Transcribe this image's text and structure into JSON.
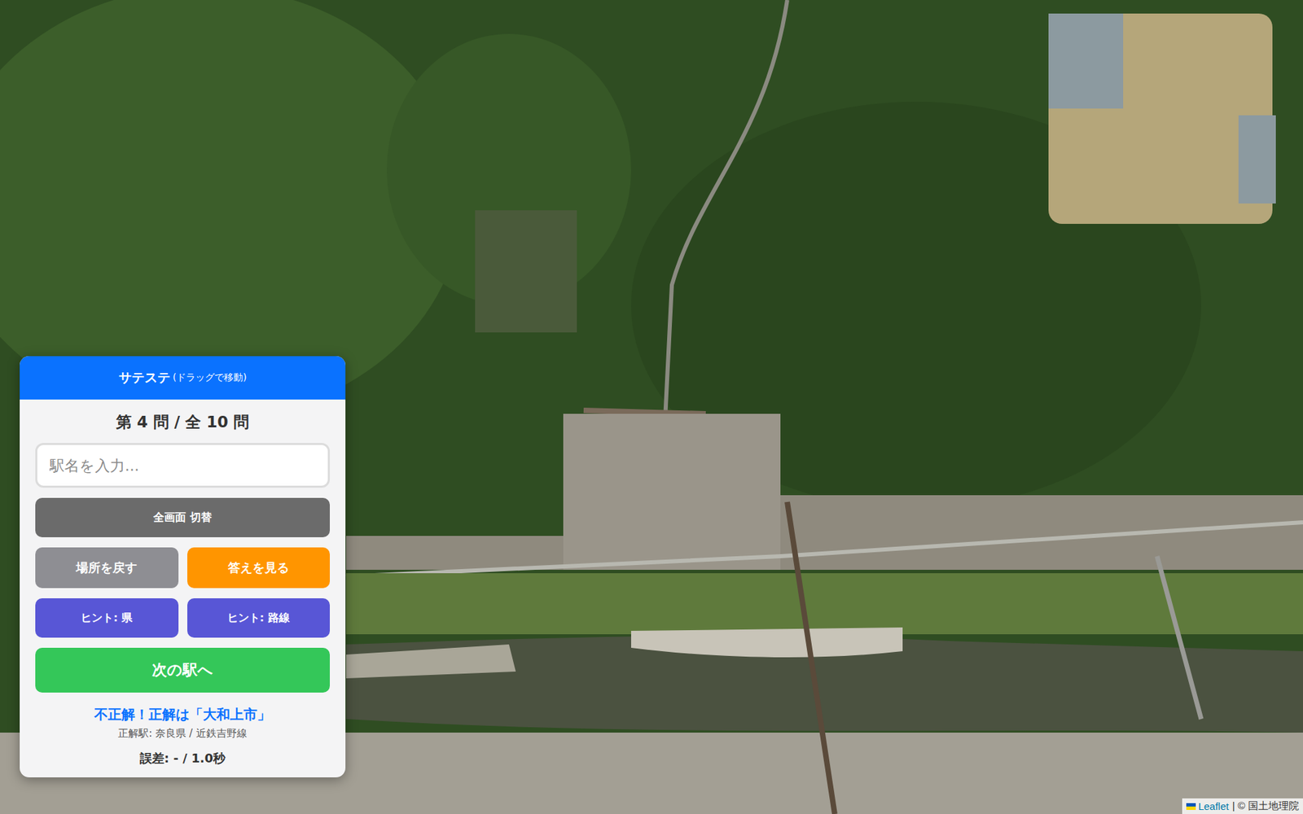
{
  "panel": {
    "title": "サテステ",
    "subtitle": "(ドラッグで移動)",
    "question": "第 4 問 / 全 10 問",
    "input": {
      "placeholder": "駅名を入力..."
    },
    "button_rows": [
      [
        {
          "label": "全画面 切替",
          "color": "#6b6b6b",
          "kind": "small"
        }
      ],
      [
        {
          "label": "場所を戻す",
          "color": "#8e8e93",
          "kind": "medium"
        },
        {
          "label": "答えを見る",
          "color": "#ff9500",
          "kind": "medium"
        }
      ],
      [
        {
          "label": "ヒント: 県",
          "color": "#5856d6",
          "kind": "small"
        },
        {
          "label": "ヒント: 路線",
          "color": "#5856d6",
          "kind": "small"
        }
      ],
      [
        {
          "label": "次の駅へ",
          "color": "#34c759",
          "kind": "large"
        }
      ]
    ],
    "result": "不正解！正解は「大和上市」",
    "answer": "正解駅: 奈良県 / 近鉄吉野線",
    "error": "誤差: - / 1.0秒"
  },
  "attribution": {
    "link": "Leaflet",
    "text": "| © 国土地理院"
  }
}
